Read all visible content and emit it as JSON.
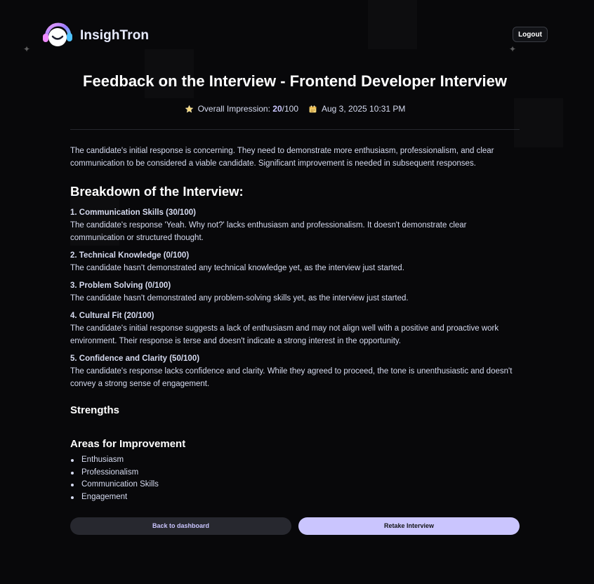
{
  "app": {
    "brand_name": "InsighTron",
    "logout_label": "Logout"
  },
  "feedback": {
    "title": "Feedback on the Interview - Frontend Developer Interview",
    "impression_label": "Overall Impression: ",
    "score": "20",
    "score_suffix": "/100",
    "date": "Aug 3, 2025 10:31 PM",
    "summary": "The candidate's initial response is concerning. They need to demonstrate more enthusiasm, professionalism, and clear communication to be considered a viable candidate. Significant improvement is needed in subsequent responses.",
    "breakdown_title": "Breakdown of the Interview:",
    "categories": [
      {
        "heading": "1. Communication Skills (30/100)",
        "text": "The candidate's response 'Yeah. Why not?' lacks enthusiasm and professionalism. It doesn't demonstrate clear communication or structured thought."
      },
      {
        "heading": "2. Technical Knowledge (0/100)",
        "text": "The candidate hasn't demonstrated any technical knowledge yet, as the interview just started."
      },
      {
        "heading": "3. Problem Solving (0/100)",
        "text": "The candidate hasn't demonstrated any problem-solving skills yet, as the interview just started."
      },
      {
        "heading": "4. Cultural Fit (20/100)",
        "text": "The candidate's initial response suggests a lack of enthusiasm and may not align well with a positive and proactive work environment. Their response is terse and doesn't indicate a strong interest in the opportunity."
      },
      {
        "heading": "5. Confidence and Clarity (50/100)",
        "text": "The candidate's response lacks confidence and clarity. While they agreed to proceed, the tone is unenthusiastic and doesn't convey a strong sense of engagement."
      }
    ],
    "strengths_title": "Strengths",
    "improvement_title": "Areas for Improvement",
    "improvements": [
      "Enthusiasm",
      "Professionalism",
      "Communication Skills",
      "Engagement"
    ]
  },
  "actions": {
    "back_label": "Back to dashboard",
    "retake_label": "Retake Interview"
  },
  "icons": {
    "impression": "star-icon",
    "date": "calendar-icon"
  },
  "colors": {
    "accent": "#cac5fe",
    "background": "#08080a",
    "secondary_button": "#27282f"
  }
}
